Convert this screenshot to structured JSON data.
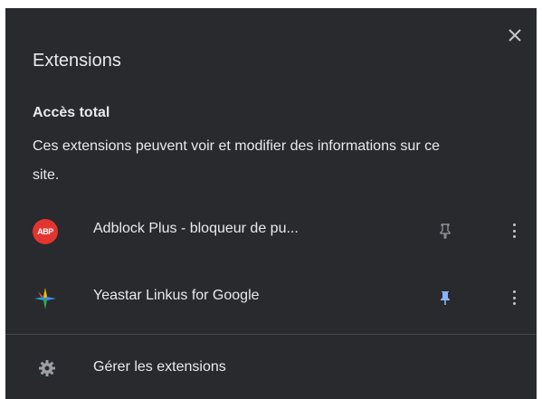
{
  "popup": {
    "title": "Extensions",
    "close_icon": "close-icon"
  },
  "access_section": {
    "heading": "Accès total",
    "description": "Ces extensions peuvent voir et modifier des informations sur ce site."
  },
  "extensions": [
    {
      "name": "Adblock Plus - bloqueur de pu...",
      "icon_text": "ABP",
      "icon": "abp-icon",
      "pinned": false
    },
    {
      "name": "Yeastar Linkus for Google",
      "icon": "yeastar-icon",
      "pinned": true
    }
  ],
  "footer": {
    "manage_label": "Gérer les extensions",
    "icon": "gear-icon"
  },
  "colors": {
    "background": "#292a2d",
    "text": "#e8eaed",
    "pinned_color": "#8ab4f8",
    "unpinned_color": "#9aa0a6",
    "abp_red": "#e3342f"
  }
}
